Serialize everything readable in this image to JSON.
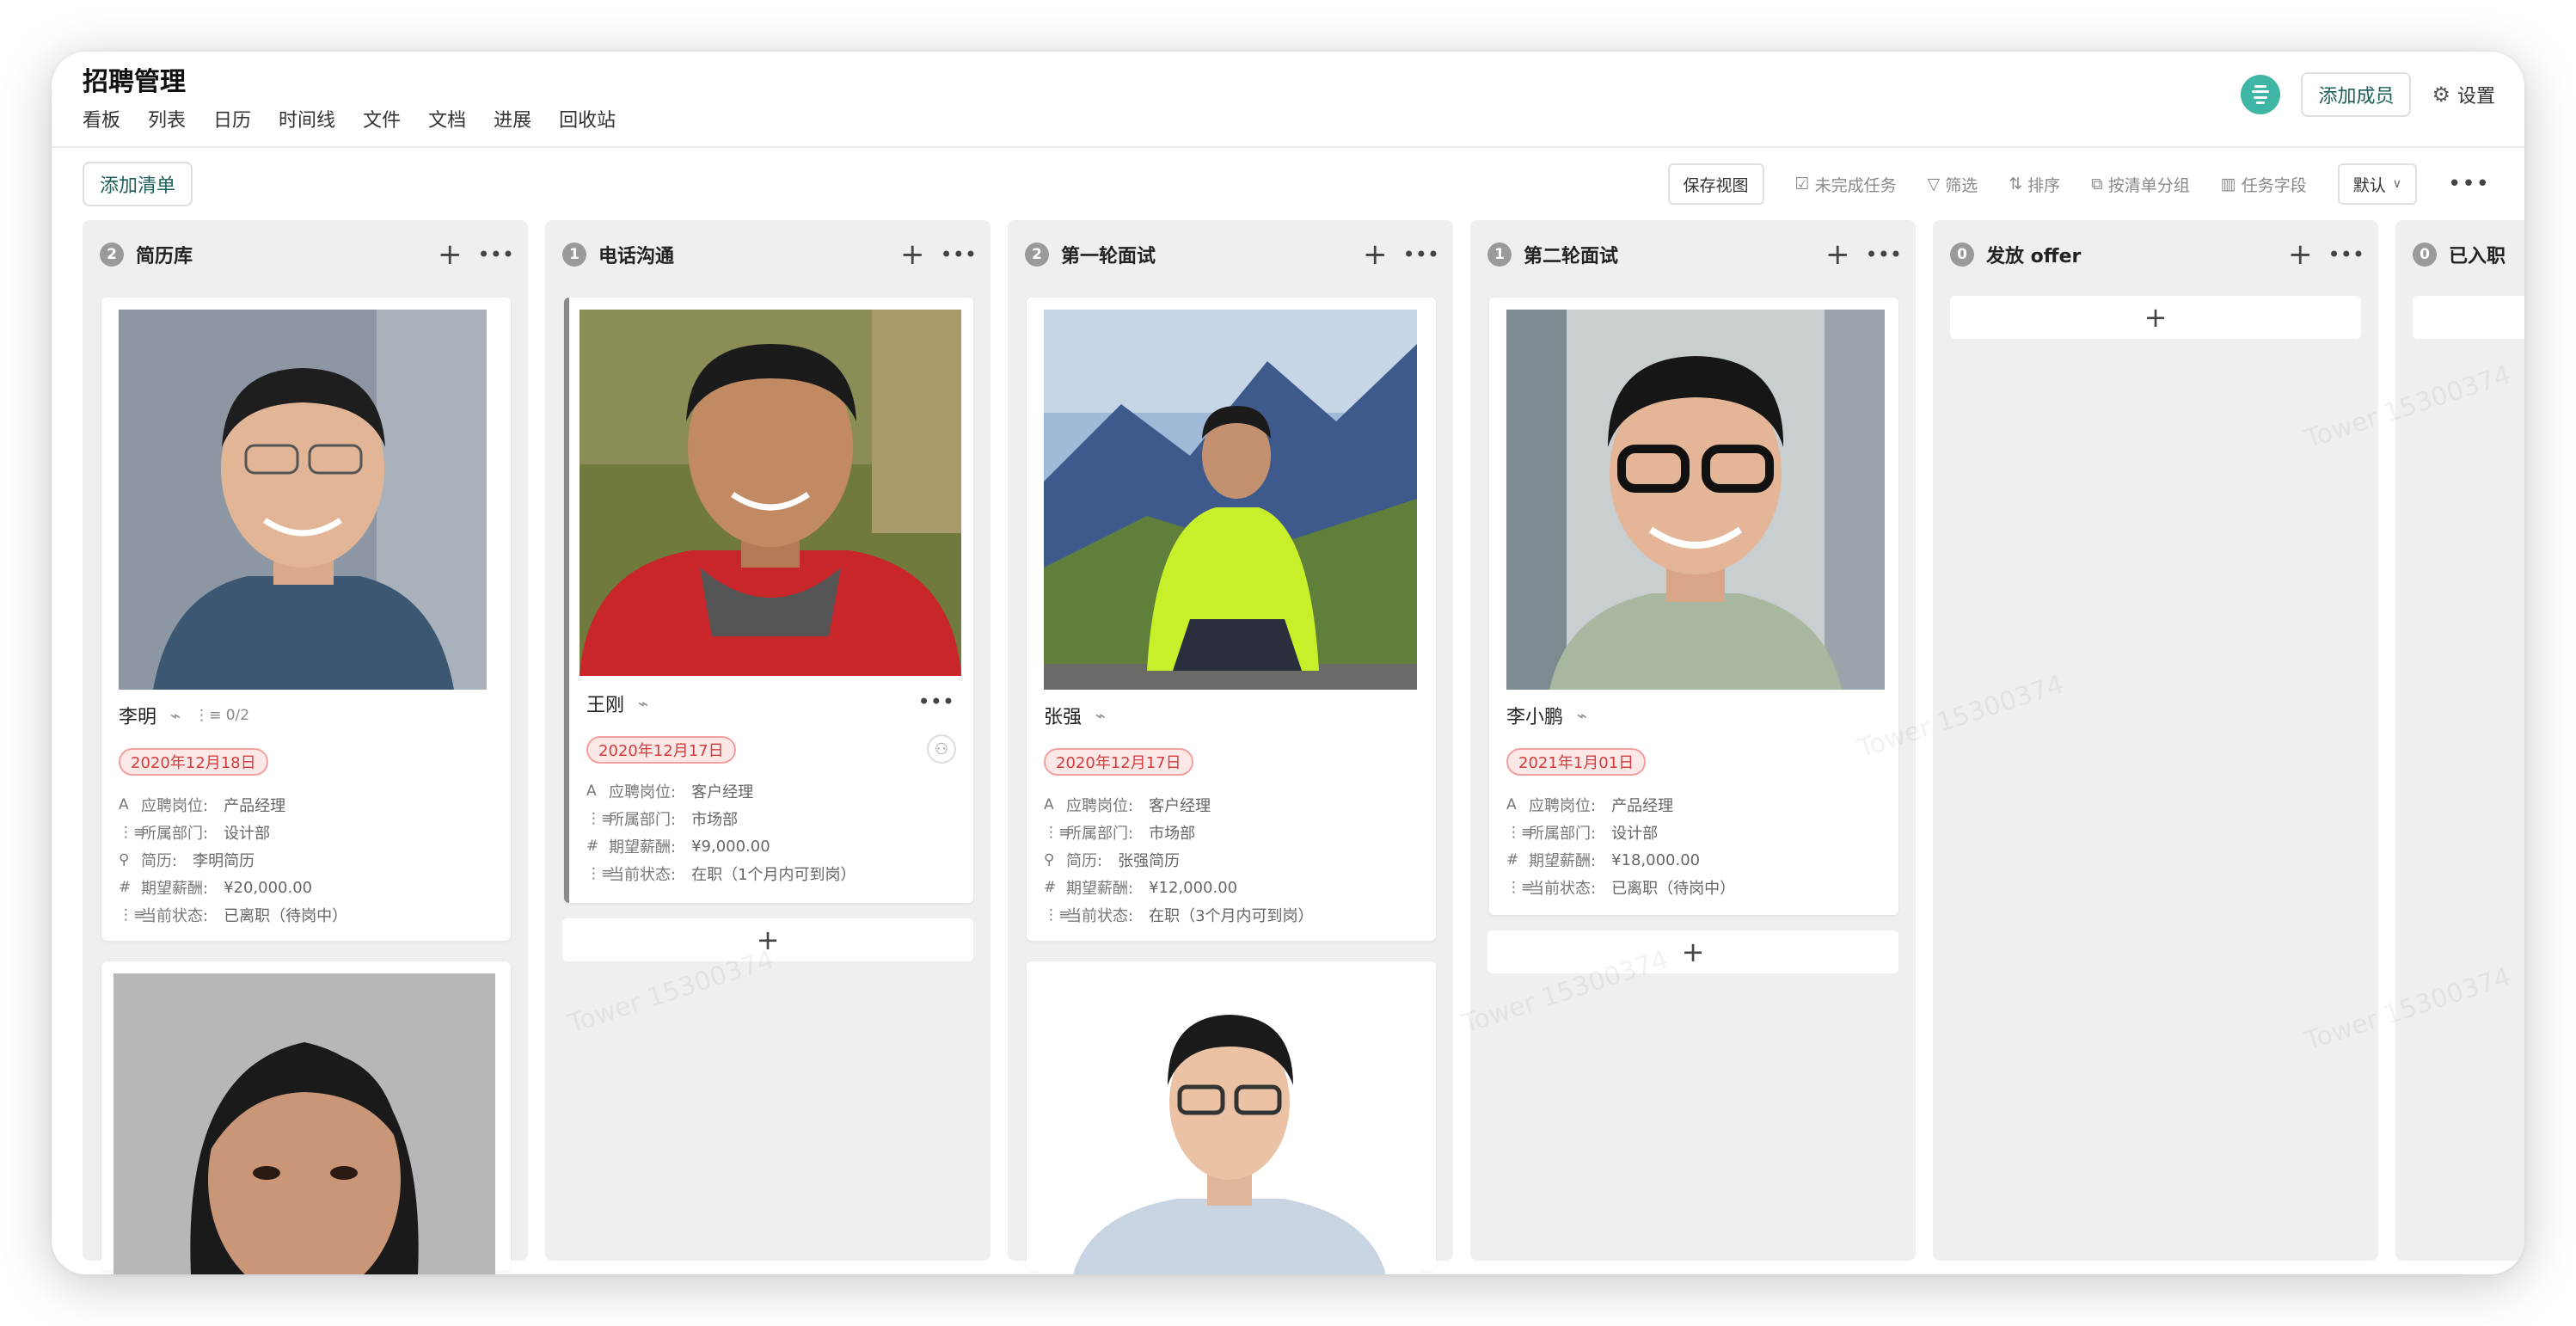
{
  "project": {
    "title": "招聘管理",
    "tabs": [
      "看板",
      "列表",
      "日历",
      "时间线",
      "文件",
      "文档",
      "进展",
      "回收站"
    ]
  },
  "header": {
    "add_member": "添加成员",
    "settings": "设置"
  },
  "toolbar": {
    "add_list": "添加清单",
    "save_view": "保存视图",
    "incomplete": "未完成任务",
    "filter": "筛选",
    "sort": "排序",
    "group": "按清单分组",
    "fields": "任务字段",
    "default": "默认"
  },
  "watermark": "Tower 15300374",
  "columns": [
    {
      "count": "2",
      "title": "简历库",
      "cards": [
        {
          "name": "李明",
          "subtasks": "0/2",
          "date": "2020年12月18日",
          "fields": [
            {
              "icon": "A",
              "label": "应聘岗位:",
              "value": "产品经理"
            },
            {
              "icon": "⋮≡",
              "label": "所属部门:",
              "value": "设计部"
            },
            {
              "icon": "⚲",
              "label": "简历:",
              "value": "李明简历"
            },
            {
              "icon": "#",
              "label": "期望薪酬:",
              "value": "¥20,000.00"
            },
            {
              "icon": "⋮≡",
              "label": "当前状态:",
              "value": "已离职（待岗中）"
            }
          ]
        }
      ]
    },
    {
      "count": "1",
      "title": "电话沟通",
      "cards": [
        {
          "name": "王刚",
          "date": "2020年12月17日",
          "fields": [
            {
              "icon": "A",
              "label": "应聘岗位:",
              "value": "客户经理"
            },
            {
              "icon": "⋮≡",
              "label": "所属部门:",
              "value": "市场部"
            },
            {
              "icon": "#",
              "label": "期望薪酬:",
              "value": "¥9,000.00"
            },
            {
              "icon": "⋮≡",
              "label": "当前状态:",
              "value": "在职（1个月内可到岗）"
            }
          ]
        }
      ]
    },
    {
      "count": "2",
      "title": "第一轮面试",
      "cards": [
        {
          "name": "张强",
          "date": "2020年12月17日",
          "fields": [
            {
              "icon": "A",
              "label": "应聘岗位:",
              "value": "客户经理"
            },
            {
              "icon": "⋮≡",
              "label": "所属部门:",
              "value": "市场部"
            },
            {
              "icon": "⚲",
              "label": "简历:",
              "value": "张强简历"
            },
            {
              "icon": "#",
              "label": "期望薪酬:",
              "value": "¥12,000.00"
            },
            {
              "icon": "⋮≡",
              "label": "当前状态:",
              "value": "在职（3个月内可到岗）"
            }
          ]
        }
      ]
    },
    {
      "count": "1",
      "title": "第二轮面试",
      "cards": [
        {
          "name": "李小鹏",
          "date": "2021年1月01日",
          "fields": [
            {
              "icon": "A",
              "label": "应聘岗位:",
              "value": "产品经理"
            },
            {
              "icon": "⋮≡",
              "label": "所属部门:",
              "value": "设计部"
            },
            {
              "icon": "#",
              "label": "期望薪酬:",
              "value": "¥18,000.00"
            },
            {
              "icon": "⋮≡",
              "label": "当前状态:",
              "value": "已离职（待岗中）"
            }
          ]
        }
      ]
    },
    {
      "count": "0",
      "title": "发放 offer",
      "cards": []
    },
    {
      "count": "0",
      "title": "已入职",
      "cards": []
    }
  ]
}
